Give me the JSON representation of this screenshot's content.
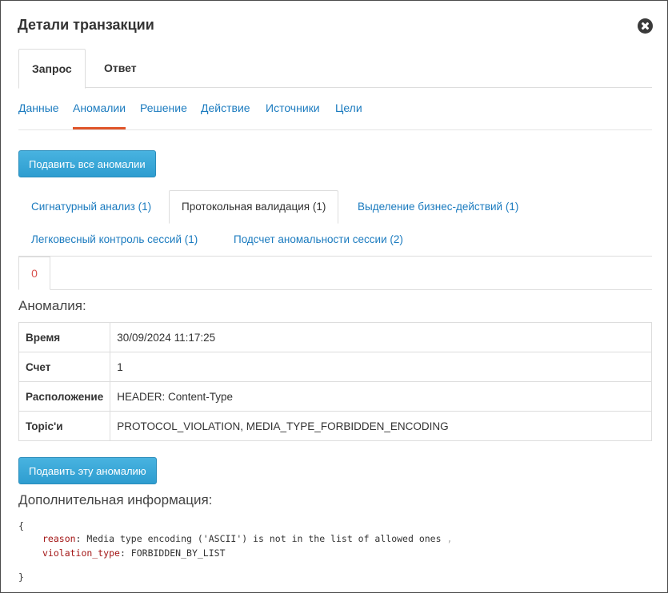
{
  "modal": {
    "title": "Детали транзакции"
  },
  "top_tabs": [
    "Запрос",
    "Ответ"
  ],
  "link_tabs": [
    "Данные",
    "Аномалии",
    "Решение",
    "Действие",
    "Источники",
    "Цели"
  ],
  "buttons": {
    "suppress_all": "Подавить все аномалии",
    "suppress_this": "Подавить эту аномалию"
  },
  "sub_tabs": [
    "Сигнатурный анализ (1)",
    "Протокольная валидация (1)",
    "Выделение бизнес-действий (1)",
    "Легковесный контроль сессий (1)",
    "Подсчет аномальности сессии (2)"
  ],
  "index_tabs": [
    "0"
  ],
  "anomaly": {
    "heading": "Аномалия:",
    "rows": [
      {
        "key": "Время",
        "value": "30/09/2024 11:17:25"
      },
      {
        "key": "Счет",
        "value": "1"
      },
      {
        "key": "Расположение",
        "value": "HEADER: Content-Type"
      },
      {
        "key": "Topic'и",
        "value": "PROTOCOL_VIOLATION, MEDIA_TYPE_FORBIDDEN_ENCODING"
      }
    ]
  },
  "extra": {
    "heading": "Дополнительная информация:",
    "open_brace": "{",
    "close_brace": "}",
    "fields": [
      {
        "key": "reason",
        "sep": ": ",
        "value": "Media type encoding ('ASCII') is not in the list of allowed ones",
        "comma": " ,"
      },
      {
        "key": "violation_type",
        "sep": ": ",
        "value": "FORBIDDEN_BY_LIST",
        "comma": ""
      }
    ]
  },
  "colors": {
    "link": "#1b7bbf",
    "active_underline": "#e0552a",
    "button": "#35a5d6",
    "code_key": "#a31515",
    "index_tab": "#d9534f"
  },
  "icons": {
    "close": "close-icon"
  }
}
